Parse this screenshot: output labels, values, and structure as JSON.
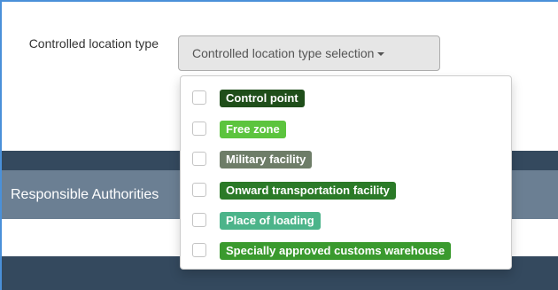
{
  "form": {
    "field_label": "Controlled location type",
    "dropdown_label": "Controlled location type selection"
  },
  "section": {
    "responsible_authorities": "Responsible Authorities"
  },
  "options": [
    {
      "label": "Control point",
      "color": "#1f4e1a"
    },
    {
      "label": "Free zone",
      "color": "#5cc43e"
    },
    {
      "label": "Military facility",
      "color": "#6e7d68"
    },
    {
      "label": "Onward transportation facility",
      "color": "#2b7a28"
    },
    {
      "label": "Place of loading",
      "color": "#4cb48a"
    },
    {
      "label": "Specially approved customs warehouse",
      "color": "#3a9a2e"
    }
  ]
}
